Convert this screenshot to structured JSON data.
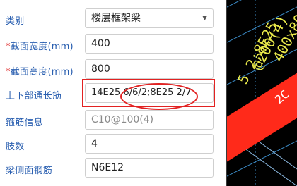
{
  "form": {
    "rows": [
      {
        "label": "类别",
        "required": false,
        "value": "楼层框架梁",
        "type": "select"
      },
      {
        "label": "截面宽度(mm)",
        "required": true,
        "value": "400",
        "type": "input"
      },
      {
        "label": "截面高度(mm)",
        "required": true,
        "value": "800",
        "type": "input"
      },
      {
        "label": "上下部通长筋",
        "required": false,
        "value": "14E25 6/6/2;8E25 2/7",
        "type": "input"
      },
      {
        "label": "箍筋信息",
        "required": false,
        "value": "C10@100(4)",
        "type": "input"
      },
      {
        "label": "肢数",
        "required": false,
        "value": "4",
        "type": "input"
      },
      {
        "label": "梁侧面钢筋",
        "required": false,
        "value": "N6E12",
        "type": "input"
      }
    ]
  },
  "canvas": {
    "texts": [
      "400x80",
      "@200(4)",
      "5 2;8E25",
      "2C"
    ]
  },
  "colors": {
    "label": "#2a5fb0",
    "required_star": "#e03030",
    "highlight": "#e22222",
    "cad_text": "#e8e84a",
    "beam": "#ff2a1a"
  }
}
